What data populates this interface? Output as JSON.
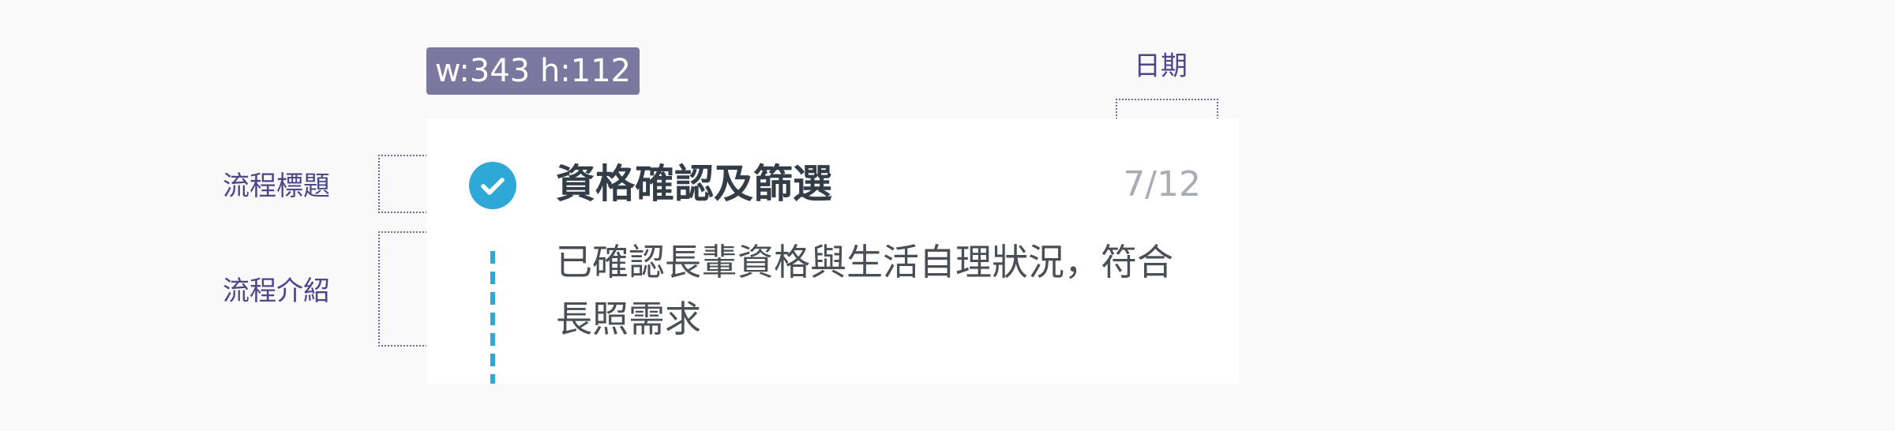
{
  "dimension_badge": "w:343 h:112",
  "annotations": {
    "date_label": "日期",
    "title_label": "流程標題",
    "description_label": "流程介紹"
  },
  "step_card": {
    "icon": "check-circle-icon",
    "title": "資格確認及篩選",
    "date": "7/12",
    "description": "已確認長輩資格與生活自理狀況，符合長照需求",
    "status": "completed"
  },
  "colors": {
    "background": "#f9f9fa",
    "badge": "#7b78a0",
    "annotation": "#4b4789",
    "check": "#2ea8d6",
    "connector": "#2ea8d6",
    "title": "#333d48",
    "date": "#a9adb3",
    "description": "#4a4f55"
  }
}
